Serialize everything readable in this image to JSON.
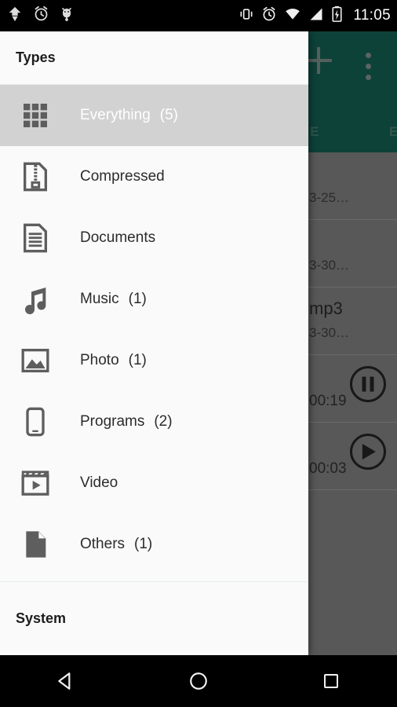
{
  "statusbar": {
    "time": "11:05",
    "left_icons": [
      {
        "name": "download-icon"
      },
      {
        "name": "alarm-clock-icon"
      },
      {
        "name": "android-debug-icon"
      }
    ],
    "right_icons": [
      {
        "name": "vibrate-icon"
      },
      {
        "name": "alarm-clock-icon"
      },
      {
        "name": "wifi-icon"
      },
      {
        "name": "cell-signal-icon"
      },
      {
        "name": "battery-charging-icon"
      }
    ]
  },
  "appbar": {
    "add_label": "+",
    "overflow_label": "More options",
    "background": "#0d4239",
    "tabs": [
      {
        "label": "ONE"
      },
      {
        "label": "E"
      }
    ]
  },
  "background_rows": [
    {
      "title": "",
      "subtitle": "3-25…",
      "time": "",
      "action": ""
    },
    {
      "title": "",
      "subtitle": "3-30…",
      "time": "",
      "action": ""
    },
    {
      "title": "mp3",
      "subtitle": "3-30…",
      "time": "",
      "action": ""
    },
    {
      "title": "",
      "subtitle": "",
      "time": "00:19",
      "action": "pause"
    },
    {
      "title": "",
      "subtitle": "",
      "time": "00:03",
      "action": "play"
    }
  ],
  "drawer": {
    "header_title": "Types",
    "footer_title": "System",
    "selected_background": "#d2d2d2",
    "items": [
      {
        "label": "Everything",
        "count": "(5)",
        "icon": "grid-icon",
        "selected": true
      },
      {
        "label": "Compressed",
        "count": "",
        "icon": "zip-file-icon",
        "selected": false
      },
      {
        "label": "Documents",
        "count": "",
        "icon": "document-icon",
        "selected": false
      },
      {
        "label": "Music",
        "count": "(1)",
        "icon": "music-note-icon",
        "selected": false
      },
      {
        "label": "Photo",
        "count": "(1)",
        "icon": "photo-icon",
        "selected": false
      },
      {
        "label": "Programs",
        "count": "(2)",
        "icon": "phone-icon",
        "selected": false
      },
      {
        "label": "Video",
        "count": "",
        "icon": "clapperboard-icon",
        "selected": false
      },
      {
        "label": "Others",
        "count": "(1)",
        "icon": "file-icon",
        "selected": false
      }
    ]
  },
  "navbar": {
    "back_label": "Back",
    "home_label": "Home",
    "recents_label": "Recents"
  }
}
